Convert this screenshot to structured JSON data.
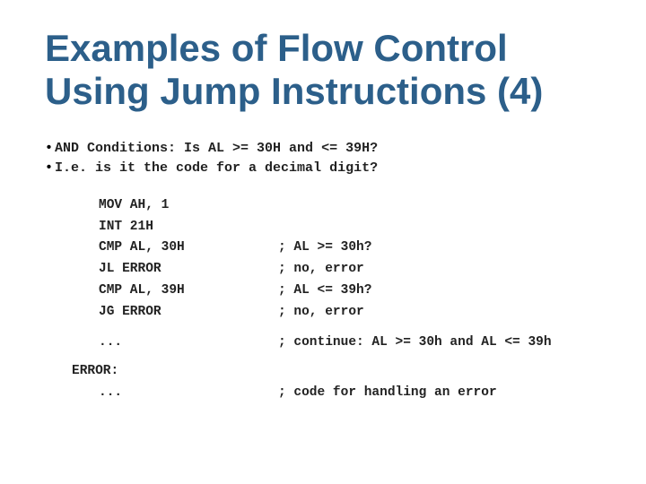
{
  "slide": {
    "title_line1": "Examples of Flow Control",
    "title_line2": "Using Jump Instructions (4)",
    "bullet1": "AND Conditions:  Is AL >= 30H and <= 39H?",
    "bullet2": "I.e. is it the code for a decimal digit?",
    "code": {
      "lines": [
        {
          "instruction": "MOV AH, 1",
          "comment": ""
        },
        {
          "instruction": "INT 21H",
          "comment": ""
        },
        {
          "instruction": "CMP AL, 30H",
          "comment": "; AL >= 30h?"
        },
        {
          "instruction": "JL ERROR",
          "comment": "; no, error"
        },
        {
          "instruction": "CMP AL, 39H",
          "comment": "; AL <= 39h?"
        },
        {
          "instruction": "JG ERROR",
          "comment": "; no, error"
        }
      ],
      "continue_instruction": "...",
      "continue_comment": "; continue: AL >= 30h and AL <= 39h"
    },
    "error": {
      "label": "ERROR:",
      "instruction": "...",
      "comment": "; code for handling an error"
    }
  }
}
